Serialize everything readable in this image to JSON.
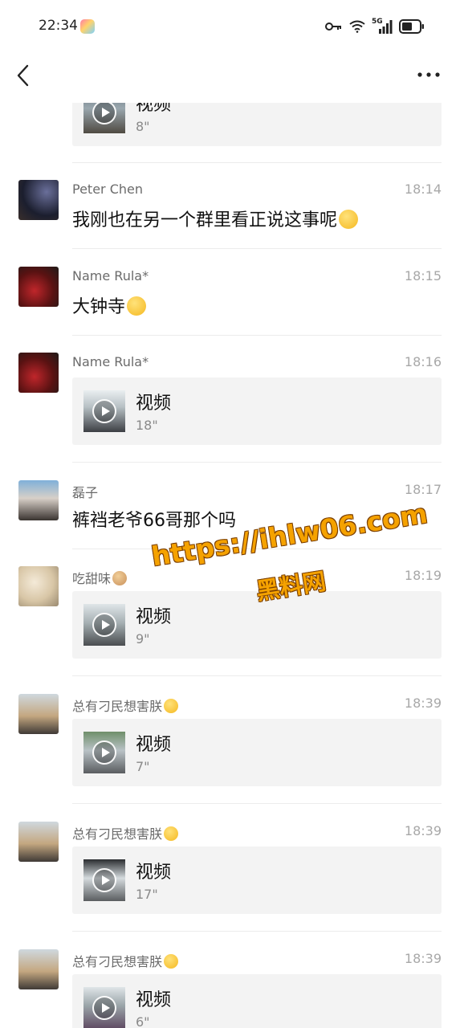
{
  "status_bar": {
    "time": "22:34",
    "network": "5G"
  },
  "watermark": {
    "url": "https://ihlw06.com",
    "label": "黑料网"
  },
  "messages": [
    {
      "type": "video",
      "video_title": "视频",
      "video_duration": "8\""
    },
    {
      "sender": "Peter Chen",
      "time": "18:14",
      "type": "text",
      "text": "我刚也在另一个群里看正说这事呢",
      "text_emoji": "laughing-tears-emoji"
    },
    {
      "sender": "Name Rula*",
      "time": "18:15",
      "type": "text",
      "text": "大钟寺",
      "text_emoji": "sad-emoji"
    },
    {
      "sender": "Name Rula*",
      "time": "18:16",
      "type": "video",
      "video_title": "视频",
      "video_duration": "18\""
    },
    {
      "sender": "磊子",
      "time": "18:17",
      "type": "text",
      "text": "裤裆老爷66哥那个吗"
    },
    {
      "sender": "吃甜味",
      "sender_emoji": "monkey-emoji",
      "time": "18:19",
      "type": "video",
      "video_title": "视频",
      "video_duration": "9\""
    },
    {
      "sender": "总有刁民想害朕",
      "sender_emoji": "smirk-emoji",
      "time": "18:39",
      "type": "video",
      "video_title": "视频",
      "video_duration": "7\""
    },
    {
      "sender": "总有刁民想害朕",
      "sender_emoji": "smirk-emoji",
      "time": "18:39",
      "type": "video",
      "video_title": "视频",
      "video_duration": "17\""
    },
    {
      "sender": "总有刁民想害朕",
      "sender_emoji": "smirk-emoji",
      "time": "18:39",
      "type": "video",
      "video_title": "视频",
      "video_duration": "6\""
    }
  ]
}
